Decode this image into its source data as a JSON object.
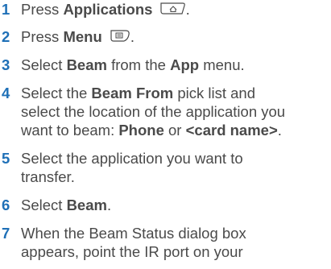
{
  "steps": [
    {
      "number": "1",
      "text": {
        "a": "Press ",
        "b": "Applications"
      },
      "icon": "applications-key-icon",
      "end": "."
    },
    {
      "number": "2",
      "text": {
        "a": "Press ",
        "b": "Menu"
      },
      "icon": "menu-key-icon",
      "end": "."
    },
    {
      "number": "3",
      "text": {
        "a": "Select ",
        "b": "Beam",
        "c": " from the ",
        "d": "App",
        "e": " menu."
      }
    },
    {
      "number": "4",
      "lines": {
        "l1a": "Select the ",
        "l1b": "Beam From",
        "l1c": " pick list and",
        "l2": "select the location of the application you",
        "l3a": "want to beam: ",
        "l3b": "Phone",
        "l3c": " or ",
        "l3d": "<card name>",
        "l3e": "."
      }
    },
    {
      "number": "5",
      "lines": {
        "l1": "Select the application you want to",
        "l2": "transfer."
      }
    },
    {
      "number": "6",
      "text": {
        "a": "Select ",
        "b": "Beam",
        "c": "."
      }
    },
    {
      "number": "7",
      "lines": {
        "l1": "When the Beam Status dialog box",
        "l2": "appears, point the IR port on your"
      }
    }
  ],
  "colors": {
    "step_number": "#1f70b7",
    "body_text": "#4a4a4a"
  }
}
